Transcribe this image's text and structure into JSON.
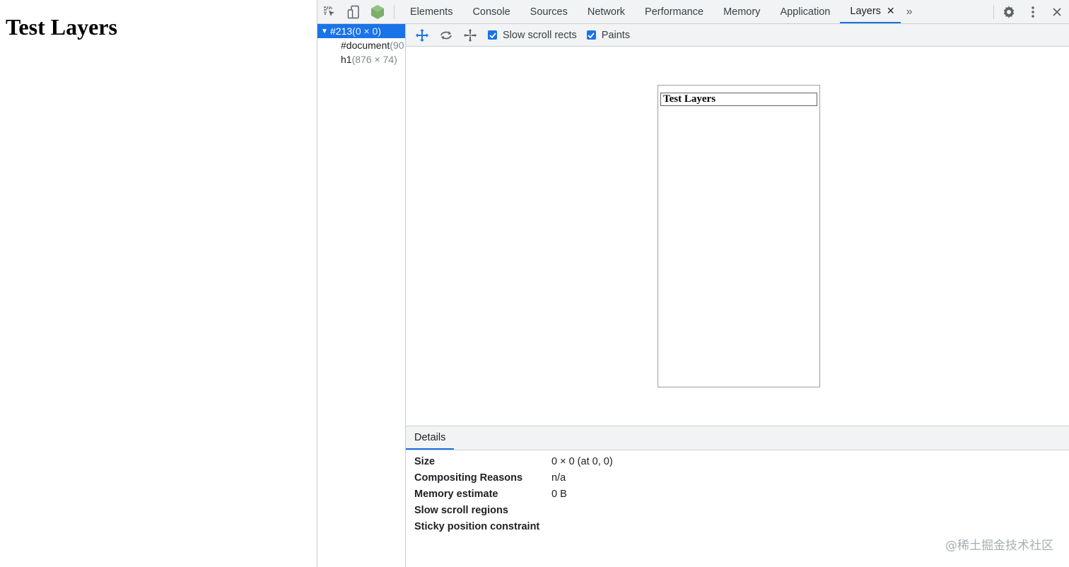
{
  "page": {
    "heading": "Test Layers"
  },
  "devtools": {
    "toolbar_icons": [
      "inspect-element-icon",
      "device-toolbar-icon",
      "node-icon"
    ],
    "tabs": [
      {
        "label": "Elements"
      },
      {
        "label": "Console"
      },
      {
        "label": "Sources"
      },
      {
        "label": "Network"
      },
      {
        "label": "Performance"
      },
      {
        "label": "Memory"
      },
      {
        "label": "Application"
      },
      {
        "label": "Layers",
        "active": true
      }
    ],
    "more_tabs": "»",
    "close_glyph": "✕"
  },
  "layer_tree": {
    "rows": [
      {
        "name": "#213",
        "dims": "(0 × 0)",
        "selected": true
      },
      {
        "name": "#document",
        "dims": "(90"
      },
      {
        "name": "h1",
        "dims": "(876 × 74)"
      }
    ]
  },
  "layers_toolbar": {
    "slow_scroll_rects": {
      "label": "Slow scroll rects",
      "checked": true
    },
    "paints": {
      "label": "Paints",
      "checked": true
    }
  },
  "canvas": {
    "layer_text": "Test Layers"
  },
  "details": {
    "tab_label": "Details",
    "rows": [
      {
        "key": "Size",
        "value": "0 × 0 (at 0, 0)"
      },
      {
        "key": "Compositing Reasons",
        "value": "n/a"
      },
      {
        "key": "Memory estimate",
        "value": "0 B"
      },
      {
        "key": "Slow scroll regions",
        "value": ""
      },
      {
        "key": "Sticky position constraint",
        "value": ""
      }
    ]
  },
  "watermark": "@稀土掘金技术社区",
  "colors": {
    "accent": "#1a73e8",
    "toolbar_bg": "#f1f3f4",
    "border": "#cbcdd1"
  }
}
